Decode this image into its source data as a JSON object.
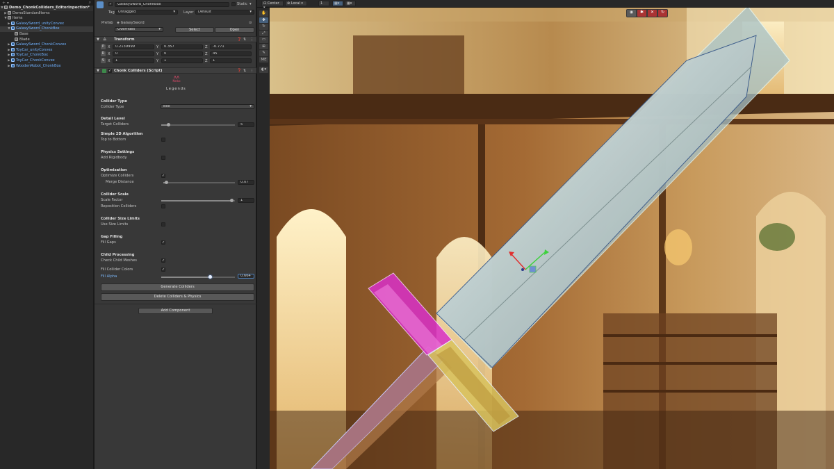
{
  "hierarchy": {
    "scene_title": "Demo_ChonkColliders_EditorInpection*",
    "items": [
      {
        "label": "DemoStandardItems",
        "indent": 1
      },
      {
        "label": "Items",
        "indent": 1
      },
      {
        "label": "GalaxySword_unityConvex",
        "indent": 2
      },
      {
        "label": "GalaxySword_ChonkBox",
        "indent": 2
      },
      {
        "label": "Base",
        "indent": 3
      },
      {
        "label": "Blade",
        "indent": 3
      },
      {
        "label": "GalaxySword_ChonkConvex",
        "indent": 2
      },
      {
        "label": "ToyCar_unityConvex",
        "indent": 2
      },
      {
        "label": "ToyCar_ChonkBox",
        "indent": 2
      },
      {
        "label": "ToyCar_ChonkConvex",
        "indent": 2
      },
      {
        "label": "WoodenRobot_ChonkBox",
        "indent": 2
      }
    ]
  },
  "inspector": {
    "object_name": "GalaxySword_ChonkBox",
    "static_label": "Static",
    "tag_label": "Tag",
    "tag_value": "Untagged",
    "layer_label": "Layer",
    "layer_value": "Default",
    "prefab_label": "Prefab",
    "prefab_value": "GalaxySword",
    "overrides_label": "Overrides",
    "select_label": "Select",
    "open_label": "Open",
    "transform": {
      "title": "Transform",
      "p_label": "P",
      "r_label": "R",
      "s_label": "S",
      "x_label": "X",
      "y_label": "Y",
      "z_label": "Z",
      "position": [
        "0.2139999",
        "0.357",
        "-0.771"
      ],
      "rotation": [
        "0",
        "0",
        "45"
      ],
      "scale": [
        "1",
        "1",
        "1"
      ]
    },
    "script": {
      "title": "Chonk Colliders (Script)",
      "logo_top": "Neko",
      "logo_bottom": "Legends",
      "collider_type_header": "Collider Type",
      "collider_type_label": "Collider Type",
      "collider_type_value": "Box",
      "detail_header": "Detail Level",
      "target_colliders_label": "Target Colliders",
      "target_colliders_value": "5",
      "target_colliders_fraction": 0.1,
      "algo_header": "Simple 2D Algorithm",
      "top_to_bottom_label": "Top to Bottom",
      "physics_header": "Physics Settings",
      "add_rigidbody_label": "Add Rigidbody",
      "optimization_header": "Optimization",
      "optimize_label": "Optimize Colliders",
      "merge_distance_label": "Merge Distance",
      "merge_distance_value": "0.07",
      "merge_distance_fraction": 0.04,
      "scale_header": "Collider Scale",
      "scale_factor_label": "Scale Factor",
      "scale_factor_value": "1",
      "scale_factor_fraction": 0.96,
      "reposition_label": "Reposition Colliders",
      "size_limits_header": "Collider Size Limits",
      "use_size_limits_label": "Use Size Limits",
      "gap_header": "Gap Filling",
      "fill_gaps_label": "Fill Gaps",
      "child_header": "Child Processing",
      "check_child_label": "Check Child Meshes",
      "fill_colors_label": "Fill Collider Colors",
      "fill_alpha_label": "Fill Alpha",
      "fill_alpha_value": "0.664",
      "fill_alpha_fraction": 0.664,
      "generate_label": "Generate Colliders",
      "delete_label": "Delete Colliders & Physics",
      "checkmark": "✓"
    },
    "add_component_label": "Add Component"
  },
  "scene_view": {
    "pivot_label": "Center",
    "space_label": "Local",
    "snap_value": "1",
    "tool_me_label": "ME"
  }
}
